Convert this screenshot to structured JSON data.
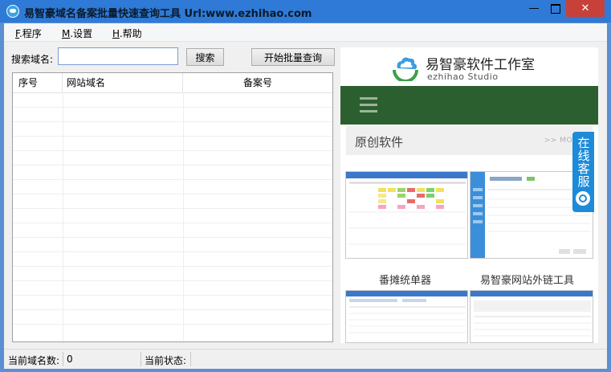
{
  "window": {
    "title": "易智豪域名备案批量快速查询工具 Url:www.ezhihao.com",
    "minimize_glyph": "—",
    "close_glyph": "✕"
  },
  "menu": {
    "items": [
      {
        "accel": "F",
        "label": ".程序"
      },
      {
        "accel": "M",
        "label": ".设置"
      },
      {
        "accel": "H",
        "label": ".帮助"
      }
    ]
  },
  "search": {
    "label": "搜索域名:",
    "value": "",
    "placeholder": "",
    "button": "搜索",
    "batch_button": "开始批量查询"
  },
  "table": {
    "columns": [
      "序号",
      "网站域名",
      "备案号"
    ],
    "rows": []
  },
  "web": {
    "logo_cn": "易智豪软件工作室",
    "logo_en": "ezhihao Studio",
    "section_title": "原创软件",
    "section_more": ">> MORE",
    "captions": [
      "番摊统单器",
      "易智豪网站外链工具"
    ],
    "service_label": "在线客服",
    "colors": {
      "nav": "#2c5f2f",
      "service": "#1e8bd8"
    }
  },
  "status": {
    "count_label": "当前域名数:",
    "count_value": "0",
    "state_label": "当前状态:",
    "state_value": ""
  },
  "colors": {
    "titlebar": "#2f7ad6",
    "close": "#c7413a"
  }
}
